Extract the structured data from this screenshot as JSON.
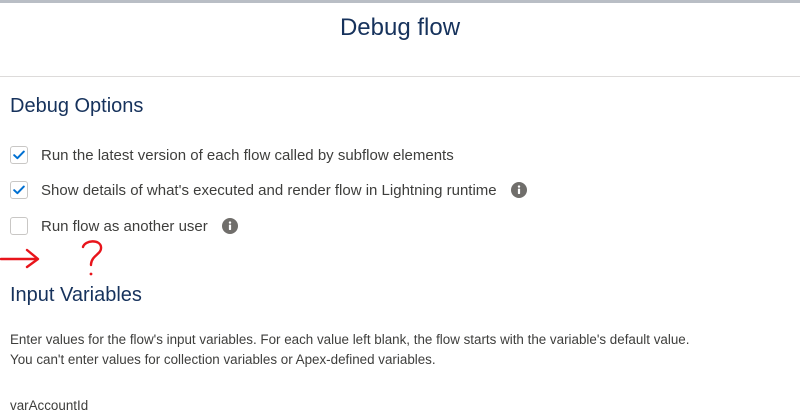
{
  "modal": {
    "title": "Debug flow"
  },
  "debug_options": {
    "heading": "Debug Options",
    "items": [
      {
        "label": "Run the latest version of each flow called by subflow elements",
        "checked": true,
        "has_info": false
      },
      {
        "label": "Show details of what's executed and render flow in Lightning runtime",
        "checked": true,
        "has_info": true
      },
      {
        "label": "Run flow as another user",
        "checked": false,
        "has_info": true
      }
    ]
  },
  "input_variables": {
    "heading": "Input Variables",
    "description_line1": "Enter values for the flow's input variables. For each value left blank, the flow starts with the variable's default value.",
    "description_line2": "You can't enter values for collection variables or Apex-defined variables.",
    "variables": [
      {
        "name": "varAccountId"
      }
    ]
  },
  "colors": {
    "heading": "#16325c",
    "text": "#3e3e3c",
    "check": "#0070d2",
    "info_icon": "#706e6b",
    "annotation": "#e8141b"
  },
  "icons": {
    "checkmark": "checkmark-icon",
    "info": "info-icon",
    "annotation_arrow": "red-arrow-annotation",
    "annotation_question": "red-question-mark-annotation"
  }
}
